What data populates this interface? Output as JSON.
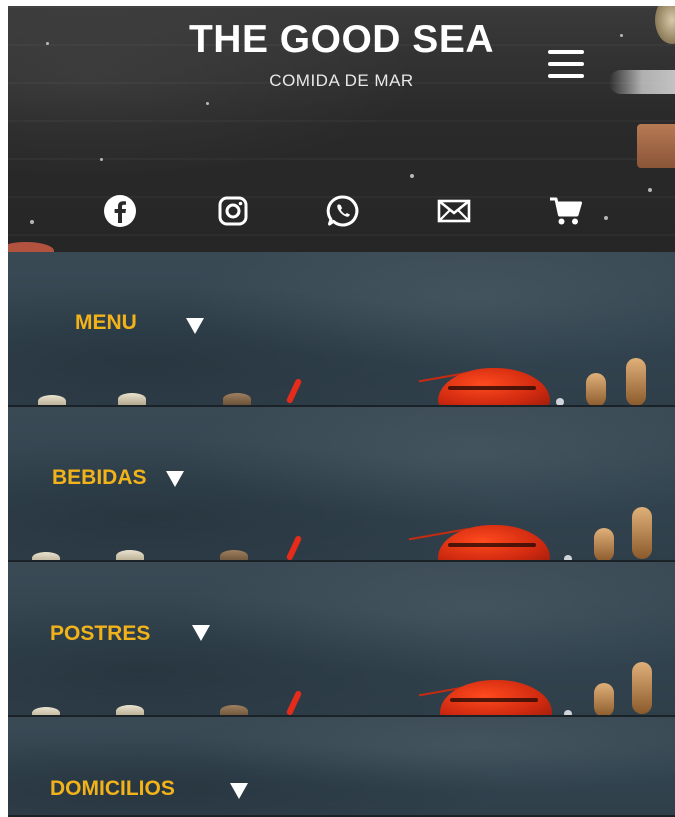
{
  "header": {
    "title": "THE GOOD SEA",
    "subtitle": "COMIDA DE MAR",
    "menu_icon": "hamburger-menu-icon",
    "social_icons": [
      "facebook-icon",
      "instagram-icon",
      "whatsapp-icon",
      "mail-icon",
      "cart-icon"
    ]
  },
  "sections": [
    {
      "label": "MENU"
    },
    {
      "label": "BEBIDAS"
    },
    {
      "label": "POSTRES"
    },
    {
      "label": "DOMICILIOS"
    }
  ],
  "colors": {
    "accent_yellow": "#f2b21a",
    "header_bg": "#2a2a2a",
    "section_bg": "#34444f",
    "lobster_red": "#e0341a"
  }
}
